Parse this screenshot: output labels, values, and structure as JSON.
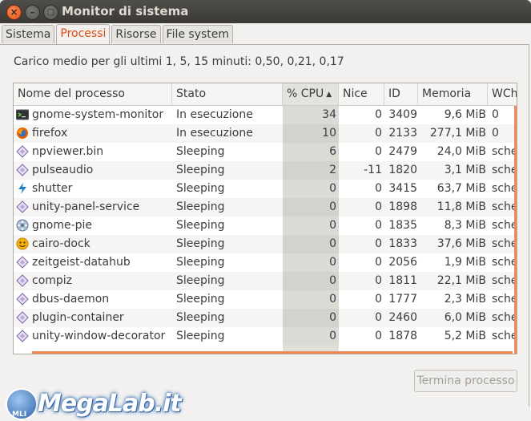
{
  "window": {
    "title": "Monitor di sistema"
  },
  "tabs": [
    {
      "label": "Sistema",
      "active": false
    },
    {
      "label": "Processi",
      "active": true
    },
    {
      "label": "Risorse",
      "active": false
    },
    {
      "label": "File system",
      "active": false
    }
  ],
  "load_average": "Carico medio per gli ultimi 1, 5, 15 minuti: 0,50, 0,21, 0,17",
  "table": {
    "columns": [
      "Nome del processo",
      "Stato",
      "% CPU",
      "Nice",
      "ID",
      "Memoria",
      "WCh"
    ],
    "sorted_column": "% CPU",
    "rows": [
      {
        "icon": "terminal-icon",
        "name": "gnome-system-monitor",
        "state": "In esecuzione",
        "cpu": "34",
        "nice": "0",
        "id": "3409",
        "mem": "9,6 MiB",
        "wchan": "0"
      },
      {
        "icon": "firefox-icon",
        "name": "firefox",
        "state": "In esecuzione",
        "cpu": "10",
        "nice": "0",
        "id": "2133",
        "mem": "277,1 MiB",
        "wchan": "0"
      },
      {
        "icon": "diamond-icon",
        "name": "npviewer.bin",
        "state": "Sleeping",
        "cpu": "6",
        "nice": "0",
        "id": "2479",
        "mem": "24,0 MiB",
        "wchan": "sche"
      },
      {
        "icon": "diamond-icon",
        "name": "pulseaudio",
        "state": "Sleeping",
        "cpu": "2",
        "nice": "-11",
        "id": "1820",
        "mem": "3,1 MiB",
        "wchan": "sche"
      },
      {
        "icon": "shutter-icon",
        "name": "shutter",
        "state": "Sleeping",
        "cpu": "0",
        "nice": "0",
        "id": "3415",
        "mem": "63,7 MiB",
        "wchan": "sche"
      },
      {
        "icon": "diamond-icon",
        "name": "unity-panel-service",
        "state": "Sleeping",
        "cpu": "0",
        "nice": "0",
        "id": "1898",
        "mem": "11,8 MiB",
        "wchan": "sche"
      },
      {
        "icon": "gnome-pie-icon",
        "name": "gnome-pie",
        "state": "Sleeping",
        "cpu": "0",
        "nice": "0",
        "id": "1835",
        "mem": "8,3 MiB",
        "wchan": "sche"
      },
      {
        "icon": "cairo-dock-icon",
        "name": "cairo-dock",
        "state": "Sleeping",
        "cpu": "0",
        "nice": "0",
        "id": "1833",
        "mem": "37,6 MiB",
        "wchan": "sche"
      },
      {
        "icon": "diamond-icon",
        "name": "zeitgeist-datahub",
        "state": "Sleeping",
        "cpu": "0",
        "nice": "0",
        "id": "2056",
        "mem": "1,9 MiB",
        "wchan": "sche"
      },
      {
        "icon": "diamond-icon",
        "name": "compiz",
        "state": "Sleeping",
        "cpu": "0",
        "nice": "0",
        "id": "1811",
        "mem": "22,1 MiB",
        "wchan": "sche"
      },
      {
        "icon": "diamond-icon",
        "name": "dbus-daemon",
        "state": "Sleeping",
        "cpu": "0",
        "nice": "0",
        "id": "1777",
        "mem": "2,3 MiB",
        "wchan": "sche"
      },
      {
        "icon": "diamond-icon",
        "name": "plugin-container",
        "state": "Sleeping",
        "cpu": "0",
        "nice": "0",
        "id": "2460",
        "mem": "6,0 MiB",
        "wchan": "sche"
      },
      {
        "icon": "diamond-icon",
        "name": "unity-window-decorator",
        "state": "Sleeping",
        "cpu": "0",
        "nice": "0",
        "id": "1878",
        "mem": "5,2 MiB",
        "wchan": "sche"
      }
    ]
  },
  "buttons": {
    "end_process": "Termina processo"
  },
  "watermark": {
    "text": "MegaLab.it",
    "badge": "MLI"
  },
  "colors": {
    "accent": "#dd4814",
    "scroll_highlight": "#f08a55"
  }
}
